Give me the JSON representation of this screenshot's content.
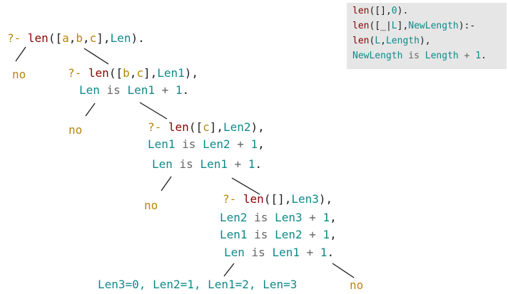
{
  "program": [
    [
      {
        "t": "len",
        "c": "pred"
      },
      {
        "t": "([],",
        "c": "punct"
      },
      {
        "t": "0",
        "c": "num"
      },
      {
        "t": ").",
        "c": "punct"
      }
    ],
    [
      {
        "t": "len",
        "c": "pred"
      },
      {
        "t": "([_|",
        "c": "punct"
      },
      {
        "t": "L",
        "c": "var"
      },
      {
        "t": "],",
        "c": "punct"
      },
      {
        "t": "NewLength",
        "c": "var"
      },
      {
        "t": "):-",
        "c": "punct"
      }
    ],
    [
      {
        "t": "len",
        "c": "pred"
      },
      {
        "t": "(",
        "c": "punct"
      },
      {
        "t": "L",
        "c": "var"
      },
      {
        "t": ",",
        "c": "punct"
      },
      {
        "t": "Length",
        "c": "var"
      },
      {
        "t": "),",
        "c": "punct"
      }
    ],
    [
      {
        "t": "NewLength",
        "c": "var"
      },
      {
        "t": " is ",
        "c": "op"
      },
      {
        "t": "Length",
        "c": "var"
      },
      {
        "t": " + ",
        "c": "op"
      },
      {
        "t": "1",
        "c": "num"
      },
      {
        "t": ".",
        "c": "punct"
      }
    ]
  ],
  "tree": {
    "query_root": [
      {
        "t": "?- ",
        "c": "prompt"
      },
      {
        "t": "len",
        "c": "pred"
      },
      {
        "t": "([",
        "c": "punct"
      },
      {
        "t": "a",
        "c": "atom"
      },
      {
        "t": ",",
        "c": "punct"
      },
      {
        "t": "b",
        "c": "atom"
      },
      {
        "t": ",",
        "c": "punct"
      },
      {
        "t": "c",
        "c": "atom"
      },
      {
        "t": "],",
        "c": "punct"
      },
      {
        "t": "Len",
        "c": "var"
      },
      {
        "t": ").",
        "c": "punct"
      }
    ],
    "query_1": [
      {
        "t": "?- ",
        "c": "prompt"
      },
      {
        "t": "len",
        "c": "pred"
      },
      {
        "t": "([",
        "c": "punct"
      },
      {
        "t": "b",
        "c": "atom"
      },
      {
        "t": ",",
        "c": "punct"
      },
      {
        "t": "c",
        "c": "atom"
      },
      {
        "t": "],",
        "c": "punct"
      },
      {
        "t": "Len1",
        "c": "var"
      },
      {
        "t": "),",
        "c": "punct"
      }
    ],
    "goal_1a": [
      {
        "t": "Len",
        "c": "var"
      },
      {
        "t": " is ",
        "c": "op"
      },
      {
        "t": "Len1",
        "c": "var"
      },
      {
        "t": " + ",
        "c": "op"
      },
      {
        "t": "1",
        "c": "num"
      },
      {
        "t": ".",
        "c": "punct"
      }
    ],
    "query_2": [
      {
        "t": "?- ",
        "c": "prompt"
      },
      {
        "t": "len",
        "c": "pred"
      },
      {
        "t": "([",
        "c": "punct"
      },
      {
        "t": "c",
        "c": "atom"
      },
      {
        "t": "],",
        "c": "punct"
      },
      {
        "t": "Len2",
        "c": "var"
      },
      {
        "t": "),",
        "c": "punct"
      }
    ],
    "goal_2a": [
      {
        "t": "Len1",
        "c": "var"
      },
      {
        "t": " is ",
        "c": "op"
      },
      {
        "t": "Len2",
        "c": "var"
      },
      {
        "t": " + ",
        "c": "op"
      },
      {
        "t": "1",
        "c": "num"
      },
      {
        "t": ",",
        "c": "punct"
      }
    ],
    "goal_2b": [
      {
        "t": "Len",
        "c": "var"
      },
      {
        "t": " is ",
        "c": "op"
      },
      {
        "t": "Len1",
        "c": "var"
      },
      {
        "t": " + ",
        "c": "op"
      },
      {
        "t": "1",
        "c": "num"
      },
      {
        "t": ".",
        "c": "punct"
      }
    ],
    "query_3": [
      {
        "t": "?- ",
        "c": "prompt"
      },
      {
        "t": "len",
        "c": "pred"
      },
      {
        "t": "([],",
        "c": "punct"
      },
      {
        "t": "Len3",
        "c": "var"
      },
      {
        "t": "),",
        "c": "punct"
      }
    ],
    "goal_3a": [
      {
        "t": "Len2",
        "c": "var"
      },
      {
        "t": " is ",
        "c": "op"
      },
      {
        "t": "Len3",
        "c": "var"
      },
      {
        "t": " + ",
        "c": "op"
      },
      {
        "t": "1",
        "c": "num"
      },
      {
        "t": ",",
        "c": "punct"
      }
    ],
    "goal_3b": [
      {
        "t": "Len1",
        "c": "var"
      },
      {
        "t": " is ",
        "c": "op"
      },
      {
        "t": "Len2",
        "c": "var"
      },
      {
        "t": " + ",
        "c": "op"
      },
      {
        "t": "1",
        "c": "num"
      },
      {
        "t": ",",
        "c": "punct"
      }
    ],
    "goal_3c": [
      {
        "t": "Len",
        "c": "var"
      },
      {
        "t": " is ",
        "c": "op"
      },
      {
        "t": "Len1",
        "c": "var"
      },
      {
        "t": " + ",
        "c": "op"
      },
      {
        "t": "1",
        "c": "num"
      },
      {
        "t": ".",
        "c": "punct"
      }
    ],
    "answer": [
      {
        "t": "Len3=0, Len2=1, Len1=2, Len=3",
        "c": "var"
      }
    ],
    "no_1": "no",
    "no_2": "no",
    "no_3": "no",
    "no_4": "no"
  },
  "colors": {
    "predicate": "#8b0000",
    "variable": "#0e8a8a",
    "atom": "#b8860b",
    "operator": "#666666",
    "code_box_background": "#e6e6e6"
  }
}
